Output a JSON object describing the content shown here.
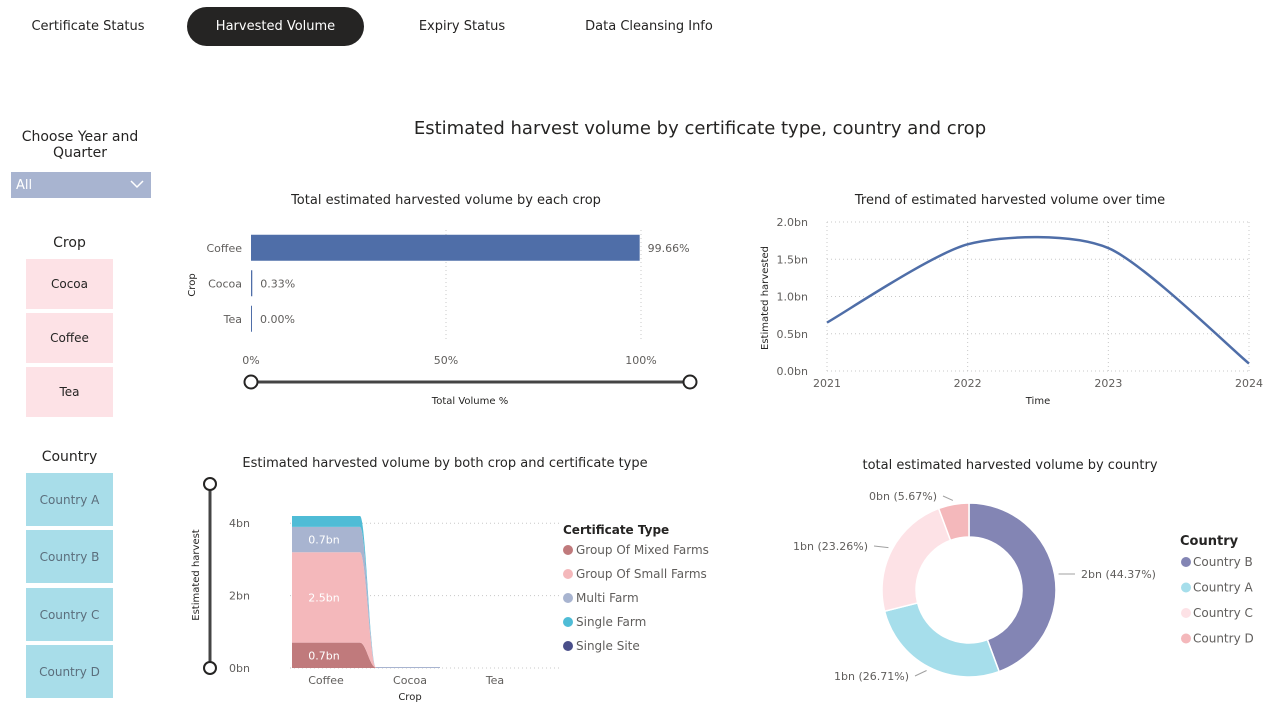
{
  "tabs": [
    {
      "label": "Certificate Status",
      "active": false
    },
    {
      "label": "Harvested Volume",
      "active": true
    },
    {
      "label": "Expiry Status",
      "active": false
    },
    {
      "label": "Data Cleansing Info",
      "active": false
    }
  ],
  "filters": {
    "year_quarter": {
      "title": "Choose Year and Quarter",
      "selected": "All"
    },
    "crop": {
      "title": "Crop",
      "items": [
        "Cocoa",
        "Coffee",
        "Tea"
      ]
    },
    "country": {
      "title": "Country",
      "items": [
        "Country A",
        "Country B",
        "Country C",
        "Country D"
      ]
    }
  },
  "page_title": "Estimated harvest volume by certificate type, country and crop",
  "colors": {
    "bar_blue": "#4f6ea8",
    "mixed": "#c07a7c",
    "small": "#f4b8bb",
    "multi": "#a8b4d0",
    "single_farm": "#4fbcd6",
    "single_site": "#4a4f8a",
    "country_b": "#8385b4",
    "country_a": "#a6deeb",
    "country_c": "#fde2e6",
    "country_d": "#f4b8bb"
  },
  "chart_data": [
    {
      "type": "bar",
      "orientation": "horizontal",
      "title": "Total estimated harvested volume by each crop",
      "xlabel": "Total Volume %",
      "ylabel": "Crop",
      "categories": [
        "Coffee",
        "Cocoa",
        "Tea"
      ],
      "values": [
        99.66,
        0.33,
        0.0
      ],
      "data_labels": [
        "99.66%",
        "0.33%",
        "0.00%"
      ],
      "xticks": [
        "0%",
        "50%",
        "100%"
      ],
      "xlim": [
        0,
        100
      ]
    },
    {
      "type": "line",
      "title": "Trend of estimated harvested volume over time",
      "xlabel": "Time",
      "ylabel": "Estimated harvested",
      "x": [
        2021,
        2022,
        2023,
        2024
      ],
      "y": [
        0.65,
        1.7,
        1.65,
        0.1
      ],
      "xticks": [
        "2021",
        "2022",
        "2023",
        "2024"
      ],
      "yticks": [
        "0.0bn",
        "0.5bn",
        "1.0bn",
        "1.5bn",
        "2.0bn"
      ],
      "ylim": [
        0,
        2.0
      ]
    },
    {
      "type": "area",
      "stacked": true,
      "title": "Estimated harvested volume by both crop and certificate type",
      "xlabel": "Crop",
      "ylabel": "Estimated harvest",
      "categories": [
        "Coffee",
        "Cocoa",
        "Tea"
      ],
      "yticks": [
        "0bn",
        "2bn",
        "4bn"
      ],
      "ylim": [
        0,
        4.2
      ],
      "legend_title": "Certificate Type",
      "series": [
        {
          "name": "Group Of Mixed Farms",
          "values": [
            0.7,
            0.01,
            0
          ],
          "label": "0.7bn"
        },
        {
          "name": "Group Of Small Farms",
          "values": [
            2.5,
            0.002,
            0
          ],
          "label": "2.5bn"
        },
        {
          "name": "Multi Farm",
          "values": [
            0.7,
            0.0,
            0
          ],
          "label": "0.7bn"
        },
        {
          "name": "Single Farm",
          "values": [
            0.3,
            0.0,
            0
          ],
          "label": ""
        },
        {
          "name": "Single Site",
          "values": [
            0.0,
            0.0,
            0
          ],
          "label": ""
        }
      ]
    },
    {
      "type": "pie",
      "donut": true,
      "title": "total estimated harvested volume by country",
      "legend_title": "Country",
      "categories": [
        "Country B",
        "Country A",
        "Country C",
        "Country D"
      ],
      "values": [
        44.37,
        26.71,
        23.26,
        5.67
      ],
      "data_labels": [
        "2bn (44.37%)",
        "1bn (26.71%)",
        "1bn (23.26%)",
        "0bn (5.67%)"
      ]
    }
  ]
}
